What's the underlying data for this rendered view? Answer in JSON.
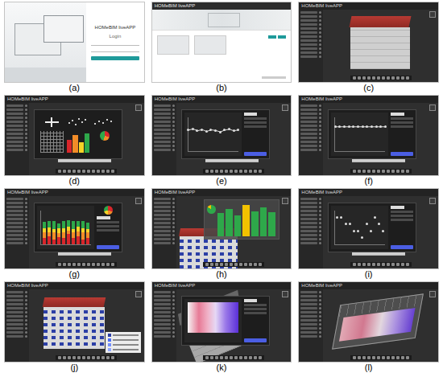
{
  "panels": [
    {
      "caption": "(a)",
      "kind": "login",
      "app_title": "HOMeBIM liveAPP",
      "subtitle": "Login"
    },
    {
      "caption": "(b)",
      "kind": "projects",
      "app_title": "HOMeBIM liveAPP"
    },
    {
      "caption": "(c)",
      "kind": "viewer",
      "app_title": "HOMeBIM liveAPP"
    },
    {
      "caption": "(d)",
      "kind": "chart-menu",
      "app_title": "HOMeBIM liveAPP"
    },
    {
      "caption": "(e)",
      "kind": "line-chart",
      "app_title": "HOMeBIM liveAPP",
      "values": [
        62,
        66,
        60,
        64,
        58,
        63,
        61,
        57,
        62,
        65,
        60,
        63
      ]
    },
    {
      "caption": "(f)",
      "kind": "line-chart",
      "app_title": "HOMeBIM liveAPP",
      "values": [
        72,
        72,
        72,
        72,
        72,
        72,
        72,
        72,
        72,
        72,
        72,
        72
      ]
    },
    {
      "caption": "(g)",
      "kind": "stacked-bars",
      "app_title": "HOMeBIM liveAPP",
      "series": [
        {
          "color": "#d9262b",
          "values": [
            20,
            25,
            15,
            22,
            18,
            30,
            20,
            25,
            15,
            20
          ]
        },
        {
          "color": "#f28c28",
          "values": [
            15,
            10,
            20,
            12,
            18,
            10,
            15,
            12,
            20,
            15
          ]
        },
        {
          "color": "#f5d327",
          "values": [
            12,
            15,
            10,
            14,
            12,
            12,
            10,
            15,
            12,
            10
          ]
        },
        {
          "color": "#2ea84a",
          "values": [
            20,
            18,
            25,
            15,
            22,
            20,
            25,
            18,
            22,
            20
          ]
        }
      ]
    },
    {
      "caption": "(h)",
      "kind": "bars",
      "app_title": "HOMeBIM liveAPP",
      "bars": [
        {
          "value": 70,
          "color": "#2ea84a"
        },
        {
          "value": 82,
          "color": "#2ea84a"
        },
        {
          "value": 64,
          "color": "#2ea84a"
        },
        {
          "value": 95,
          "color": "#f2c200"
        },
        {
          "value": 76,
          "color": "#2ea84a"
        },
        {
          "value": 88,
          "color": "#2ea84a"
        },
        {
          "value": 72,
          "color": "#2ea84a"
        }
      ]
    },
    {
      "caption": "(i)",
      "kind": "scatter",
      "app_title": "HOMeBIM liveAPP",
      "values": [
        80,
        80,
        60,
        60,
        40,
        40,
        20,
        60,
        40,
        80,
        60,
        40
      ]
    },
    {
      "caption": "(j)",
      "kind": "legend",
      "app_title": "HOMeBIM liveAPP",
      "legend": [
        {
          "color": "#2c3fa6"
        },
        {
          "color": "#4c6ef5"
        },
        {
          "color": "#748ffc"
        },
        {
          "color": "#91a7ff"
        }
      ]
    },
    {
      "caption": "(k)",
      "kind": "heatmap",
      "app_title": "HOMeBIM liveAPP"
    },
    {
      "caption": "(l)",
      "kind": "heatmap-3d",
      "app_title": "HOMeBIM liveAPP"
    }
  ]
}
